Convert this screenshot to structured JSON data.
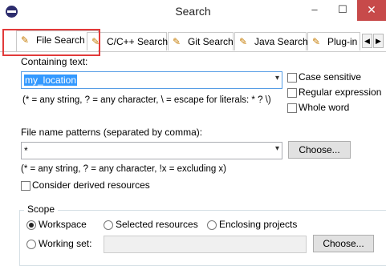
{
  "window": {
    "title": "Search",
    "minimize": "–",
    "maximize": "☐",
    "close": "✕"
  },
  "tabs": [
    {
      "label": "File Search"
    },
    {
      "label": "C/C++ Search"
    },
    {
      "label": "Git Search"
    },
    {
      "label": "Java Search"
    },
    {
      "label": "Plug-in"
    }
  ],
  "tab_scroll": {
    "left": "◀",
    "right": "▶"
  },
  "containing_text": {
    "label": "Containing text:",
    "value": "my_location",
    "hint": "(* = any string, ? = any character, \\ = escape for literals: * ? \\)"
  },
  "options": {
    "case_sensitive": "Case sensitive",
    "regular_expression": "Regular expression",
    "whole_word": "Whole word"
  },
  "file_name_patterns": {
    "label": "File name patterns (separated by comma):",
    "value": "*",
    "choose": "Choose...",
    "hint": "(* = any string, ? = any character, !x = excluding x)"
  },
  "derived": {
    "label": "Consider derived resources"
  },
  "scope": {
    "label": "Scope",
    "workspace": "Workspace",
    "selected_resources": "Selected resources",
    "enclosing_projects": "Enclosing projects",
    "working_set": "Working set:",
    "choose": "Choose..."
  },
  "icons": {
    "app": "eclipse-icon",
    "tab": "search-flashlight-icon"
  },
  "colors": {
    "highlight": "#e23a3a",
    "selection": "#3399ff",
    "close_button": "#c74a4a"
  }
}
